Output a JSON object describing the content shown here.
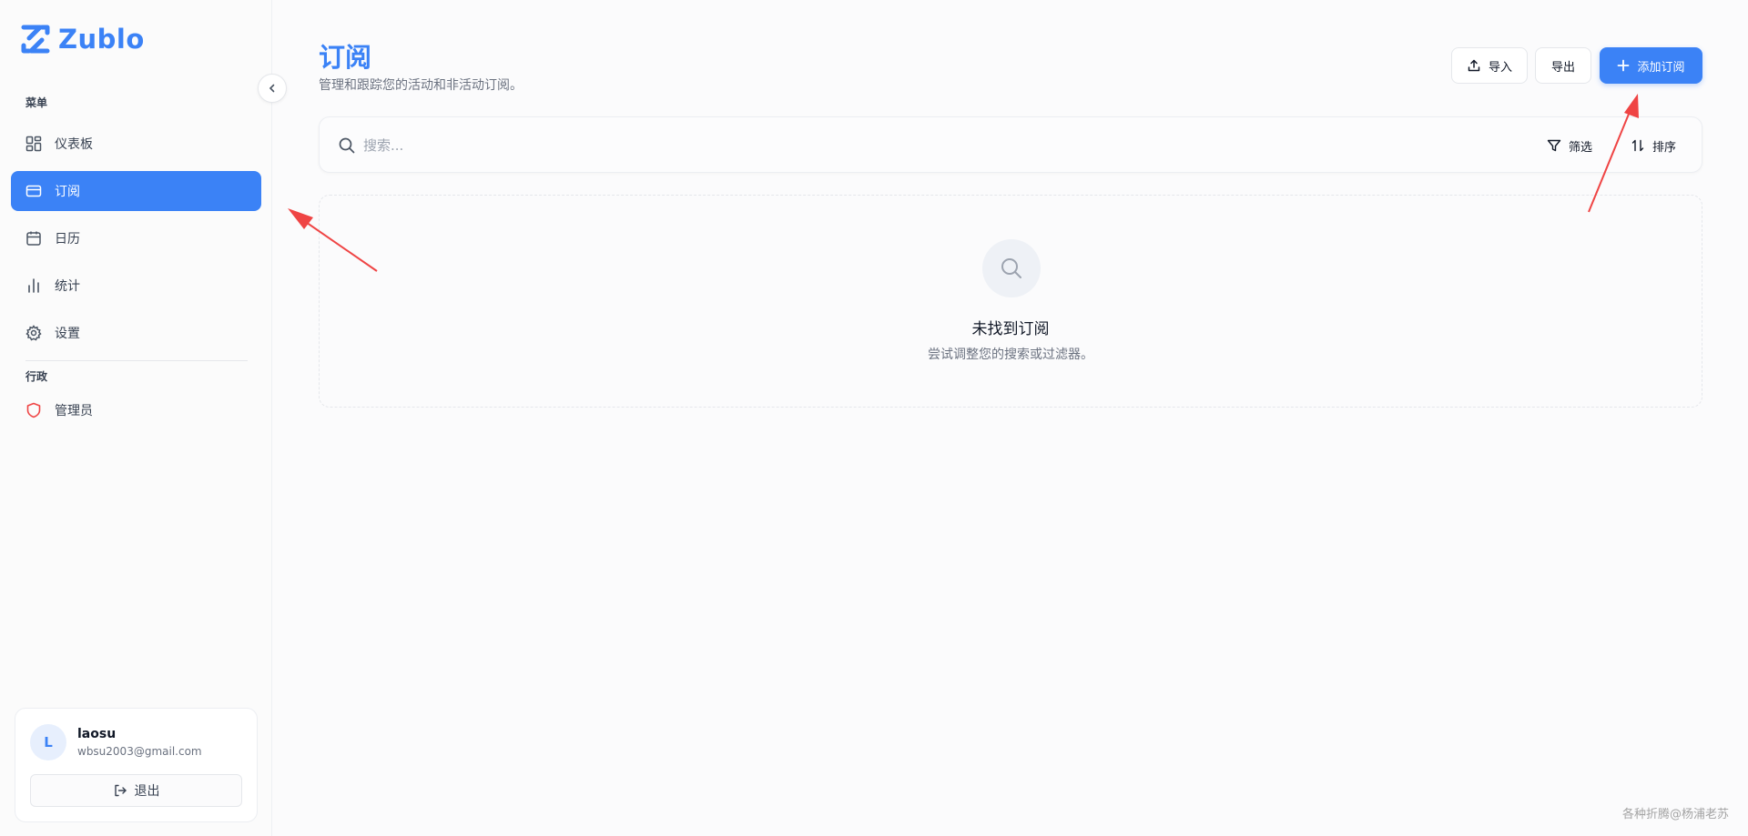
{
  "brand": {
    "name": "Zublo",
    "color": "#3b82f6"
  },
  "sidebar": {
    "menu_label": "菜单",
    "items": [
      {
        "label": "仪表板",
        "icon": "dashboard-icon"
      },
      {
        "label": "订阅",
        "icon": "credit-card-icon",
        "active": true
      },
      {
        "label": "日历",
        "icon": "calendar-icon"
      },
      {
        "label": "统计",
        "icon": "bar-chart-icon"
      },
      {
        "label": "设置",
        "icon": "gear-icon"
      }
    ],
    "admin_label": "行政",
    "admin_items": [
      {
        "label": "管理员",
        "icon": "shield-icon"
      }
    ]
  },
  "user": {
    "initial": "L",
    "name": "laosu",
    "email": "wbsu2003@gmail.com",
    "logout_label": "退出"
  },
  "header": {
    "title": "订阅",
    "subtitle": "管理和跟踪您的活动和非活动订阅。",
    "import_label": "导入",
    "export_label": "导出",
    "add_label": "添加订阅"
  },
  "search": {
    "placeholder": "搜索...",
    "filter_label": "筛选",
    "sort_label": "排序"
  },
  "empty_state": {
    "title": "未找到订阅",
    "description": "尝试调整您的搜索或过滤器。"
  },
  "watermark": "各种折腾@杨浦老苏",
  "colors": {
    "accent": "#3b82f6",
    "arrow": "#ef4444",
    "shield": "#ef4444"
  }
}
